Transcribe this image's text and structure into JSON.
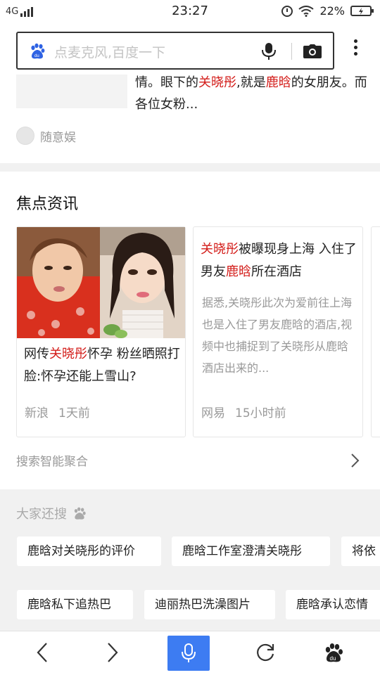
{
  "status_bar": {
    "network": "4G",
    "time": "23:27",
    "battery_percent": "22%"
  },
  "search": {
    "placeholder": "点麦克风,百度一下",
    "icons": [
      "baidu-paw-icon",
      "microphone-icon",
      "camera-icon",
      "more-vertical-icon"
    ]
  },
  "top_card": {
    "text_parts": [
      "情。眼下的",
      "关晓彤",
      ",就是",
      "鹿晗",
      "的女朋友。而各位女粉..."
    ],
    "source": "随意娱"
  },
  "focus": {
    "title": "焦点资讯",
    "cards": [
      {
        "title_parts": [
          "网传",
          "关晓彤",
          "怀孕 粉丝晒照打脸:怀孕还能上雪山?"
        ],
        "source": "新浪",
        "time": "1天前"
      },
      {
        "title_parts": [
          "关晓彤",
          "被曝现身上海 入住了男友",
          "鹿晗",
          "所在酒店"
        ],
        "description": "据悉,关晓彤此次为爱前往上海也是入住了男友鹿晗的酒店,视频中也捕捉到了关晓彤从鹿晗酒店出来的...",
        "source": "网易",
        "time": "15小时前"
      }
    ],
    "aggregate_label": "搜索智能聚合"
  },
  "related": {
    "title": "大家还搜",
    "chips": [
      "鹿晗对关晓彤的评价",
      "鹿晗工作室澄清关晓彤",
      "将依",
      "鹿晗私下追热巴",
      "迪丽热巴洗澡图片",
      "鹿晗承认恋情"
    ]
  },
  "colors": {
    "highlight": "#d31c19",
    "accent_blue": "#3d7cf2",
    "background": "#f1f1f1"
  },
  "bottom_nav": {
    "icons": [
      "back-arrow-icon",
      "forward-arrow-icon",
      "microphone-icon",
      "refresh-icon",
      "baidu-paw-icon"
    ]
  }
}
